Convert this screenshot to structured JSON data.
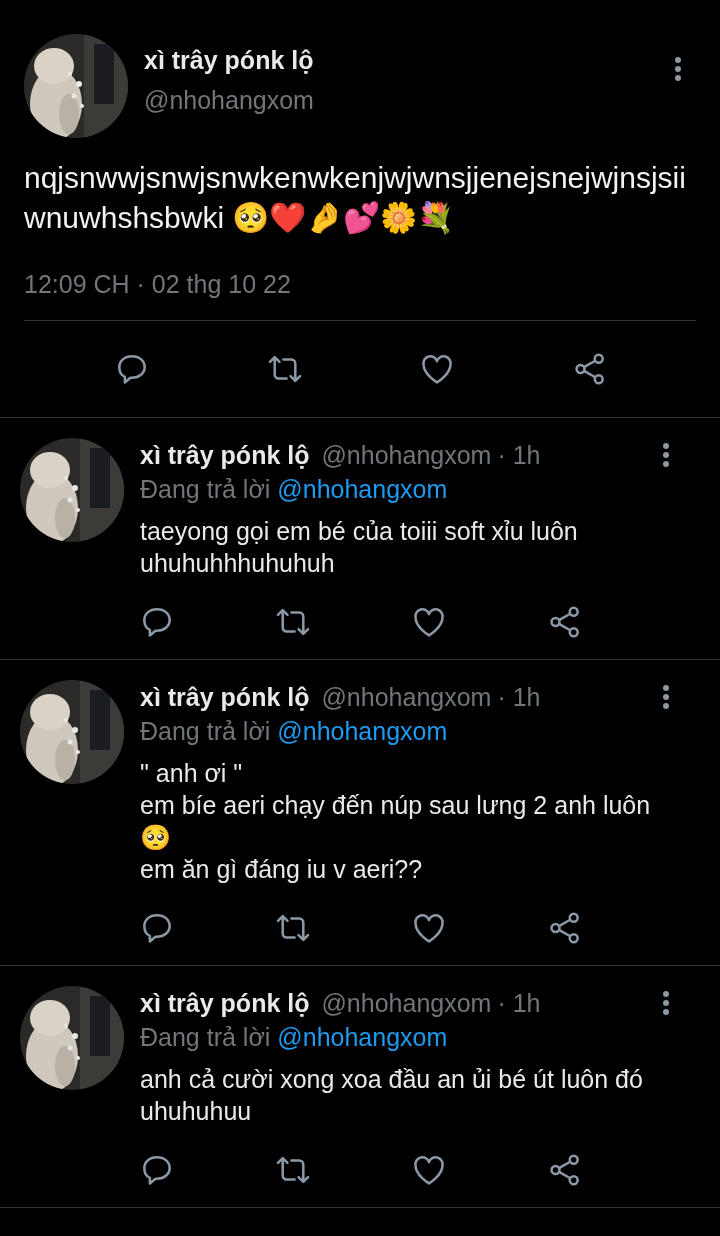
{
  "main_tweet": {
    "name": "xì trây pónk lộ",
    "handle": "@nhohangxom",
    "text": "nqjsnwwjsnwjsnwkenwkenjwjwnsjjenejsnejwjnsjsiiwnuwhshsbwki 🥺❤️🤌💕🌼💐",
    "timestamp": "12:09 CH · 02 thg 10 22"
  },
  "replies": [
    {
      "name": "xì trây pónk lộ",
      "handle": "@nhohangxom",
      "time": "· 1h",
      "replying_label": "Đang trả lời",
      "replying_to": "@nhohangxom",
      "text": "taeyong gọi em bé của toiii soft xỉu luôn uhuhuhhhuhuhuh"
    },
    {
      "name": "xì trây pónk lộ",
      "handle": "@nhohangxom",
      "time": "· 1h",
      "replying_label": "Đang trả lời",
      "replying_to": "@nhohangxom",
      "text": "\" anh ơi \"\nem bíe aeri chạy đến núp sau lưng 2 anh luôn 🥺\nem ăn gì đáng iu v aeri??"
    },
    {
      "name": "xì trây pónk lộ",
      "handle": "@nhohangxom",
      "time": "· 1h",
      "replying_label": "Đang trả lời",
      "replying_to": "@nhohangxom",
      "text": "anh cả cười xong xoa đầu an ủi bé út luôn đó uhuhuhuu"
    }
  ]
}
